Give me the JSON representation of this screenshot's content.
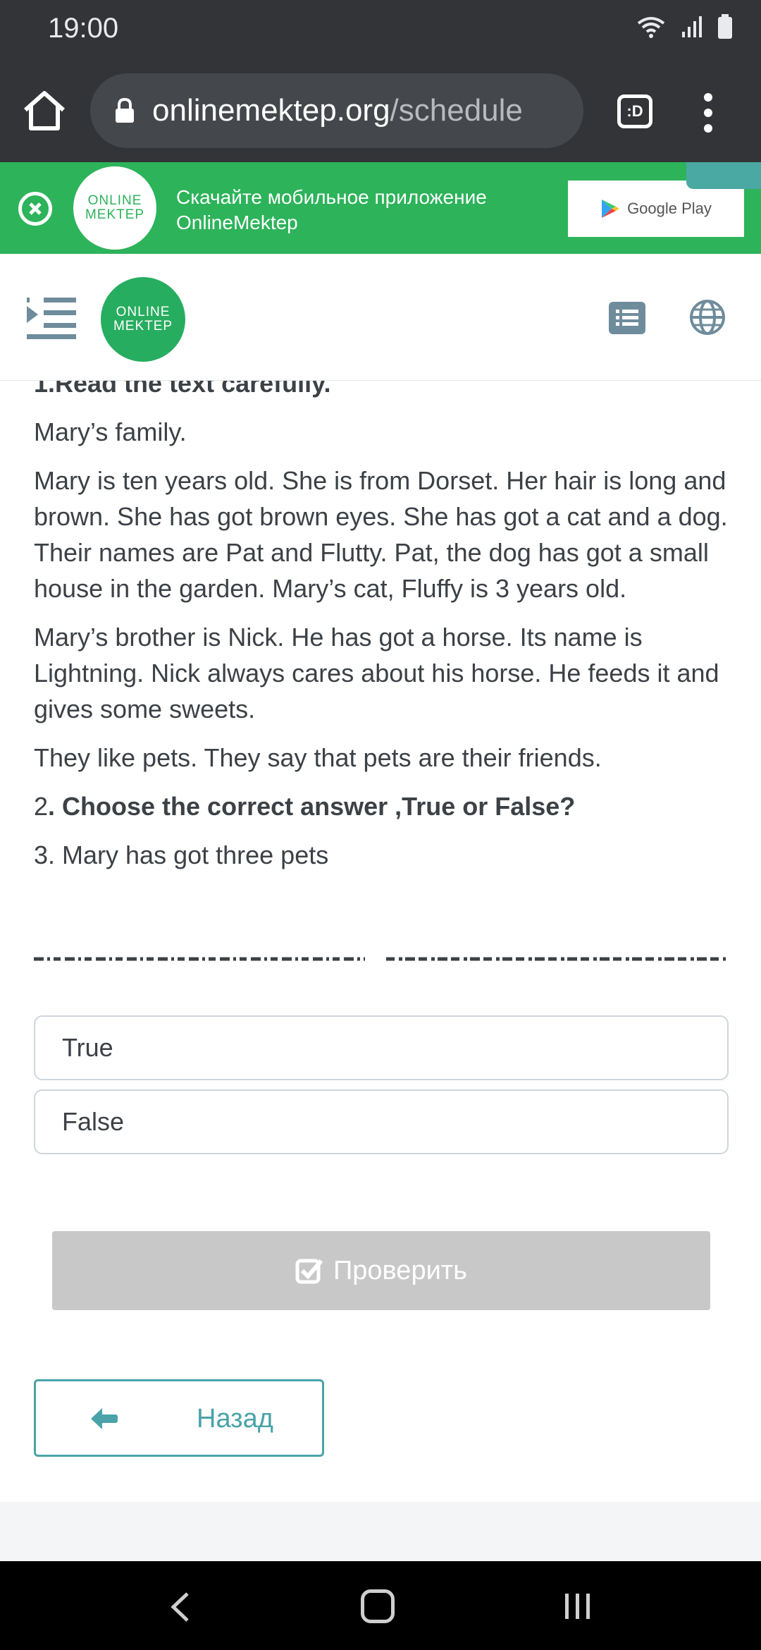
{
  "status_bar": {
    "time": "19:00"
  },
  "browser": {
    "url_domain": "onlinemektep.org",
    "url_path": "/schedule",
    "tab_label": ":D"
  },
  "banner": {
    "logo_line1": "ONLINE",
    "logo_line2": "MEKTEP",
    "text_line1": "Скачайте мобильное приложение",
    "text_line2": "OnlineMektep",
    "store_label": "Google Play"
  },
  "header": {
    "logo_line1": "ONLINE",
    "logo_line2": "MEKTEP"
  },
  "exercise": {
    "heading1_num": "1.",
    "heading1": "Read the text carefully.",
    "title": "Mary’s family.",
    "paragraph1": "Mary is ten years old. She is from Dorset. Her hair is long and brown. She has got brown eyes. She has got a cat and a dog. Their names are Pat and Flutty. Pat, the dog has got a small house in the garden. Mary’s cat, Fluffy is 3 years old.",
    "paragraph2": "Mary’s brother is Nick. He has got a horse. Its name is Lightning. Nick always cares about his horse. He feeds it and gives some sweets.",
    "paragraph3": "They like pets. They say that pets are their friends.",
    "heading2_num": "2",
    "heading2": ". Choose the correct answer ,True or False?",
    "question_num": "3",
    "question": ". Mary has got three pets"
  },
  "options": {
    "true_label": "True",
    "false_label": "False"
  },
  "actions": {
    "check_label": "Проверить",
    "back_label": "Назад"
  },
  "colors": {
    "green": "#2db35a",
    "teal": "#49a3a8",
    "disabled": "#c8c8c8",
    "dark": "#323437"
  }
}
